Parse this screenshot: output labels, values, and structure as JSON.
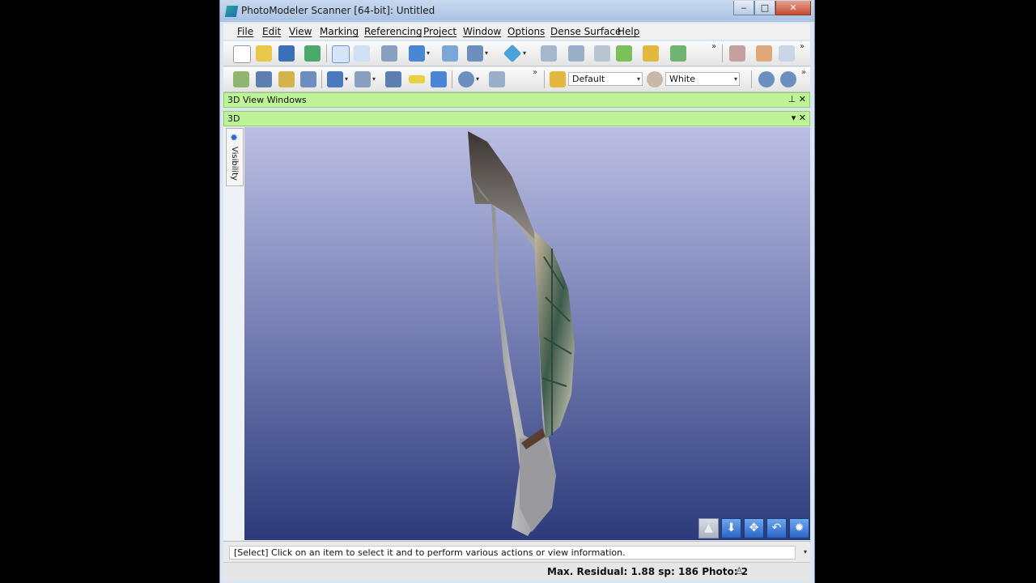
{
  "window": {
    "title": "PhotoModeler Scanner [64-bit]: Untitled",
    "min": "‒",
    "max": "□",
    "close": "✕"
  },
  "menu": {
    "items": [
      "File",
      "Edit",
      "View",
      "Marking",
      "Referencing",
      "Project",
      "Window",
      "Options",
      "Dense Surface",
      "Help"
    ]
  },
  "toolbar": {
    "overflow": "»",
    "layer_combo": "Default",
    "color_combo": "White",
    "dropdown_arrow": "▾"
  },
  "panels": {
    "windows_title": "3D View Windows",
    "windows_controls": "⊥ ✕",
    "view_title": "3D",
    "view_controls": "▾ ✕",
    "visibility_tab": "Visibility",
    "visibility_icon": "✹"
  },
  "nav_buttons": {
    "select": "▲",
    "down": "⬇",
    "pan": "✥",
    "undo": "↶",
    "settings": "✹"
  },
  "status": {
    "message": "[Select] Click on an item to select it and to perform various actions or view information.",
    "message_arrow": "▾",
    "residual": "Max. Residual: 1.88 sp: 186 Photo: 2",
    "person_icon": "♙"
  },
  "colors": {
    "panel_green": "#bff398",
    "view_top": "#bcbfe4",
    "view_bottom": "#2b3a7a"
  }
}
